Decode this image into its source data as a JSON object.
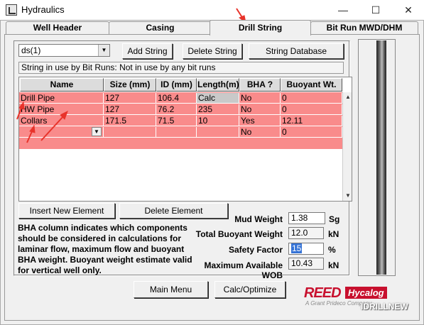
{
  "window": {
    "title": "Hydraulics",
    "min_glyph": "—",
    "max_glyph": "☐",
    "close_glyph": "✕"
  },
  "tabs": [
    {
      "label": "Well Header",
      "active": false
    },
    {
      "label": "Casing",
      "active": false
    },
    {
      "label": "Drill String",
      "active": true
    },
    {
      "label": "Bit Run MWD/DHM",
      "active": false
    }
  ],
  "toolbar": {
    "string_selected": "ds(1)",
    "add_string": "Add String",
    "delete_string": "Delete String",
    "string_database": "String Database"
  },
  "string_info": "String in use by Bit Runs: Not in use by any bit runs",
  "grid": {
    "columns": [
      "Name",
      "Size (mm)",
      "ID (mm)",
      "Length(m)",
      "BHA ?",
      "Buoyant Wt."
    ],
    "rows": [
      [
        "Drill Pipe",
        "127",
        "106.4",
        "Calc",
        "No",
        "0"
      ],
      [
        "HW Pipe",
        "127",
        "76.2",
        "235",
        "No",
        "0"
      ],
      [
        "Collars",
        "171.5",
        "71.5",
        "10",
        "Yes",
        "12.11"
      ],
      [
        "",
        "",
        "",
        "",
        "No",
        "0"
      ]
    ],
    "row_color": "#f98b8b"
  },
  "actions": {
    "insert_element": "Insert New Element",
    "delete_element": "Delete Element"
  },
  "bha_note": "BHA column indicates which components should be considered in calculations for laminar flow, maximum flow and buoyant BHA weight. Buoyant weight estimate valid for vertical well only.",
  "fields": {
    "mud_weight": {
      "label": "Mud Weight",
      "value": "1.38",
      "unit": "Sg"
    },
    "total_buoyant_weight": {
      "label": "Total Buoyant Weight",
      "value": "12.0",
      "unit": "kN"
    },
    "safety_factor": {
      "label": "Safety Factor",
      "value": "15",
      "unit": "%"
    },
    "max_wob": {
      "label": "Maximum Available WOB",
      "value": "10.43",
      "unit": "kN"
    }
  },
  "bottom": {
    "main_menu": "Main Menu",
    "calc_optimize": "Calc/Optimize"
  },
  "logo": {
    "reed": "REED",
    "hycalog": "Hycalog",
    "sub": "A Grant Prideco Company"
  },
  "watermark": "IDRILLNEW",
  "colors": {
    "accent_red": "#c8102e",
    "selection_blue": "#3573d6"
  }
}
